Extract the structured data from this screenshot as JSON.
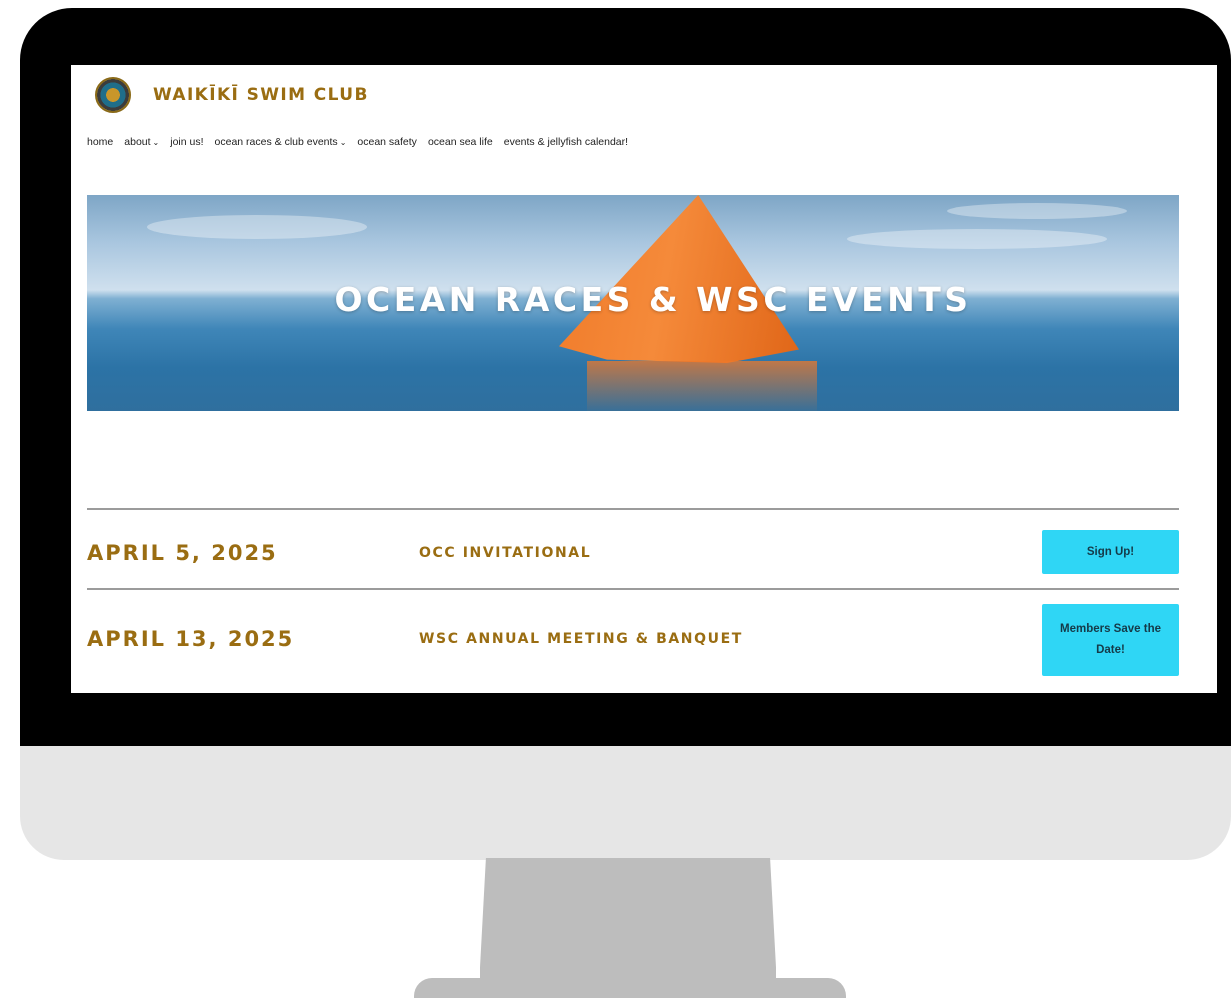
{
  "site": {
    "title": "WAIKĪKĪ SWIM CLUB"
  },
  "nav": {
    "items": [
      {
        "label": "home",
        "has_dropdown": false
      },
      {
        "label": "about",
        "has_dropdown": true
      },
      {
        "label": "join us!",
        "has_dropdown": false
      },
      {
        "label": "ocean races & club events",
        "has_dropdown": true
      },
      {
        "label": "ocean safety",
        "has_dropdown": false
      },
      {
        "label": "ocean sea life",
        "has_dropdown": false
      },
      {
        "label": "events & jellyfish calendar!",
        "has_dropdown": false
      }
    ]
  },
  "hero": {
    "title": "OCEAN RACES & WSC EVENTS"
  },
  "events": [
    {
      "date": "APRIL 5, 2025",
      "name": "OCC INVITATIONAL",
      "button": "Sign Up!"
    },
    {
      "date": "APRIL 13, 2025",
      "name": "WSC ANNUAL MEETING & BANQUET",
      "button": "Members Save the Date!"
    }
  ],
  "colors": {
    "accent_gold": "#9a6d12",
    "button_cyan": "#2fd6f5",
    "bezel": "#000000",
    "chin": "#e6e6e6",
    "stand": "#bdbdbd"
  }
}
